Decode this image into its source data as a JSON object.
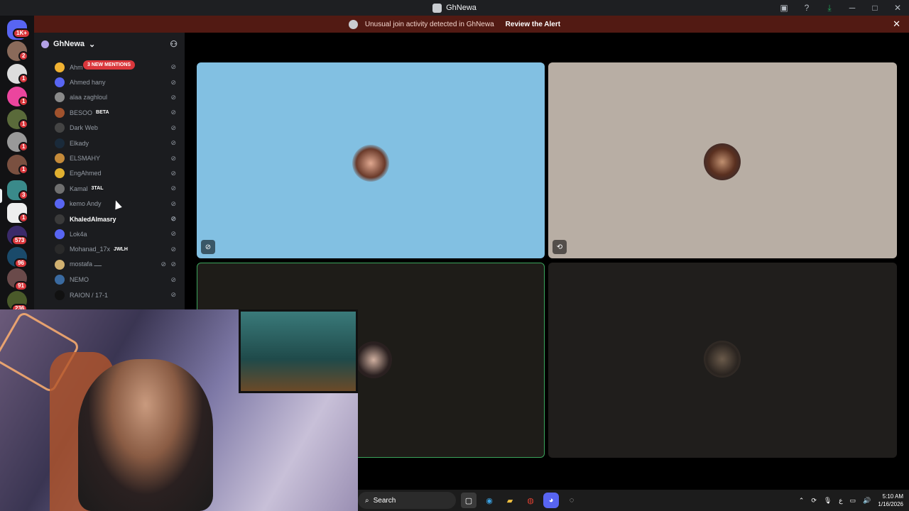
{
  "window": {
    "title": "GhNewa"
  },
  "banner": {
    "message": "Unusual join activity detected in GhNewa",
    "action": "Review the Alert"
  },
  "server": {
    "name": "GhNewa"
  },
  "server_badges": [
    "1K+",
    "2",
    "1",
    "1",
    "1",
    "1",
    "1",
    "3",
    "1",
    "573",
    "96",
    "91",
    "236"
  ],
  "mentions": "3 NEW MENTIONS",
  "members": [
    {
      "name": "Ahm",
      "color": "#f0b232",
      "tag": ""
    },
    {
      "name": "Ahmed hany",
      "color": "#5865f2",
      "tag": ""
    },
    {
      "name": "alaa zaghloul",
      "color": "#8a8a8a",
      "tag": ""
    },
    {
      "name": "BESOO",
      "color": "#a0522d",
      "tag": "BETA"
    },
    {
      "name": "Dark Web",
      "color": "#444",
      "tag": ""
    },
    {
      "name": "Elkady",
      "color": "#1a2a3a",
      "tag": ""
    },
    {
      "name": "ELSMAHY",
      "color": "#c48a3a",
      "tag": ""
    },
    {
      "name": "EngAhmed",
      "color": "#e0b030",
      "tag": ""
    },
    {
      "name": "Kamal",
      "color": "#707070",
      "tag": "3TAL"
    },
    {
      "name": "kemo Andy",
      "color": "#5865f2",
      "tag": ""
    },
    {
      "name": "KhaledAlmasry",
      "color": "#3a3a3a",
      "tag": ""
    },
    {
      "name": "Lok4a",
      "color": "#5865f2",
      "tag": ""
    },
    {
      "name": "Mohanad_17x",
      "color": "#2a2a2a",
      "tag": "JWLH"
    },
    {
      "name": "mostafa ــــ",
      "color": "#d0b070",
      "tag": ""
    },
    {
      "name": "NEMO",
      "color": "#3a6aa0",
      "tag": ""
    },
    {
      "name": "RAION / 17-1",
      "color": "#111",
      "tag": ""
    }
  ],
  "taskbar": {
    "search": "Search",
    "time": "5:10 AM",
    "date": "1/16/2026",
    "ime": "ع"
  },
  "colors": {
    "banner_bg": "#521a13",
    "tile1": "#82c0e2",
    "tile2": "#b8aea4",
    "tile3": "#1e1c18",
    "tile4": "#201e1c",
    "speaking": "#3ba55c"
  }
}
